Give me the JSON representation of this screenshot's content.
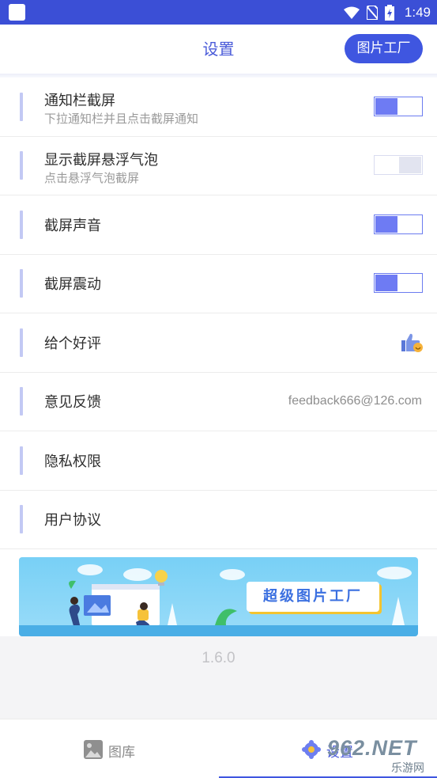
{
  "status_bar": {
    "time": "1:49"
  },
  "header": {
    "title": "设置",
    "factory_button": "图片工厂"
  },
  "settings": [
    {
      "label": "通知栏截屏",
      "sub": "下拉通知栏并且点击截屏通知",
      "control": "switch",
      "on": true
    },
    {
      "label": "显示截屏悬浮气泡",
      "sub": "点击悬浮气泡截屏",
      "control": "switch",
      "on": false
    },
    {
      "label": "截屏声音",
      "control": "switch",
      "on": true
    },
    {
      "label": "截屏震动",
      "control": "switch",
      "on": true
    },
    {
      "label": "给个好评",
      "control": "icon",
      "icon": "thumbs-up-icon"
    },
    {
      "label": "意见反馈",
      "value": "feedback666@126.com"
    },
    {
      "label": "隐私权限"
    },
    {
      "label": "用户协议"
    }
  ],
  "banner": {
    "slogan": "超级图片工厂"
  },
  "version": "1.6.0",
  "bottom_nav": [
    {
      "label": "图库",
      "icon": "gallery-icon",
      "active": false
    },
    {
      "label": "设置",
      "icon": "gear-icon",
      "active": true
    }
  ],
  "watermark": {
    "main": "962.NET",
    "sub": "乐游网"
  },
  "colors": {
    "accent": "#3f56e0",
    "switch_on": "#6e7bf3",
    "status_bar": "#3b4fd6"
  }
}
